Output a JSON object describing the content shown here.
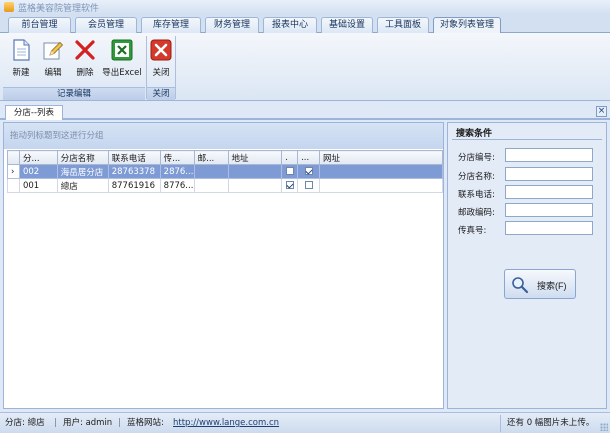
{
  "app": {
    "title": "蓝格美容院管理软件"
  },
  "tabs": [
    {
      "label": "前台管理"
    },
    {
      "label": "会员管理"
    },
    {
      "label": "库存管理"
    },
    {
      "label": "财务管理"
    },
    {
      "label": "报表中心"
    },
    {
      "label": "基础设置"
    },
    {
      "label": "工具面板"
    },
    {
      "label": "对象列表管理"
    }
  ],
  "ribbon": {
    "groups": [
      {
        "label": "记录编辑",
        "buttons": [
          {
            "label": "新建",
            "icon": "new-doc-icon"
          },
          {
            "label": "编辑",
            "icon": "pencil-icon"
          },
          {
            "label": "删除",
            "icon": "red-x-icon"
          },
          {
            "label": "导出Excel",
            "icon": "excel-icon"
          }
        ]
      },
      {
        "label": "关闭",
        "buttons": [
          {
            "label": "关闭",
            "icon": "close-red-icon"
          }
        ]
      }
    ]
  },
  "doc_tab": {
    "label": "分店--列表"
  },
  "grid": {
    "group_hint": "拖动列标题到这进行分组",
    "columns": [
      "分...",
      "分店名称",
      "联系电话",
      "传...",
      "邮...",
      "地址",
      ".",
      "...",
      "网址"
    ],
    "rows": [
      {
        "code": "002",
        "name": "海岳居分店",
        "phone": "28763378",
        "fax": "2876...",
        "zip": "",
        "addr": "",
        "chk1": false,
        "chk2": true,
        "url": "",
        "selected": true
      },
      {
        "code": "001",
        "name": "總店",
        "phone": "87761916",
        "fax": "8776...",
        "zip": "",
        "addr": "",
        "chk1": true,
        "chk2": false,
        "url": "",
        "selected": false
      }
    ]
  },
  "search": {
    "title": "搜索条件",
    "fields": [
      {
        "label": "分店编号:",
        "value": ""
      },
      {
        "label": "分店名称:",
        "value": ""
      },
      {
        "label": "联系电话:",
        "value": ""
      },
      {
        "label": "邮政编码:",
        "value": ""
      },
      {
        "label": "传真号:",
        "value": ""
      }
    ],
    "button_label": "搜索(F)"
  },
  "status": {
    "branch": "分店: 總店",
    "user": "用户: admin",
    "site_label": "蓝格网站:",
    "site_url": "http://www.lange.com.cn",
    "right_text": "还有 0 幅图片未上传。"
  },
  "colors": {
    "accent": "#7e9bd6",
    "frame": "#9bb4d8",
    "ribbon": "#dbe6f4"
  }
}
